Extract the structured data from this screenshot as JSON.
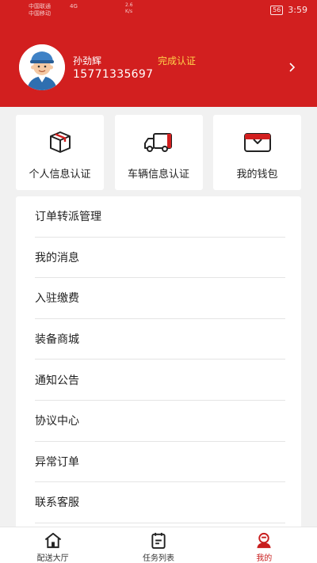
{
  "status_bar": {
    "carrier1": "中国联通",
    "carrier2": "中国移动",
    "net": "4G",
    "speed_value": "2.6",
    "speed_unit": "K/s",
    "battery": "56",
    "time": "3:59"
  },
  "profile": {
    "name": "孙劲辉",
    "phone": "15771335697",
    "cert_status": "完成认证"
  },
  "quick_actions": [
    {
      "label": "个人信息认证",
      "icon": "box-icon"
    },
    {
      "label": "车辆信息认证",
      "icon": "truck-icon"
    },
    {
      "label": "我的钱包",
      "icon": "wallet-icon"
    }
  ],
  "menu": [
    {
      "label": "订单转派管理"
    },
    {
      "label": "我的消息"
    },
    {
      "label": "入驻缴费"
    },
    {
      "label": "装备商城"
    },
    {
      "label": "通知公告"
    },
    {
      "label": "协议中心"
    },
    {
      "label": "异常订单"
    },
    {
      "label": "联系客服"
    }
  ],
  "tabs": [
    {
      "label": "配送大厅",
      "icon": "home-icon",
      "active": false
    },
    {
      "label": "任务列表",
      "icon": "clipboard-icon",
      "active": false
    },
    {
      "label": "我的",
      "icon": "user-icon",
      "active": true
    }
  ],
  "colors": {
    "header": "#d21f1f",
    "cert_text": "#ffd24a",
    "active_tab": "#c81e1e"
  }
}
